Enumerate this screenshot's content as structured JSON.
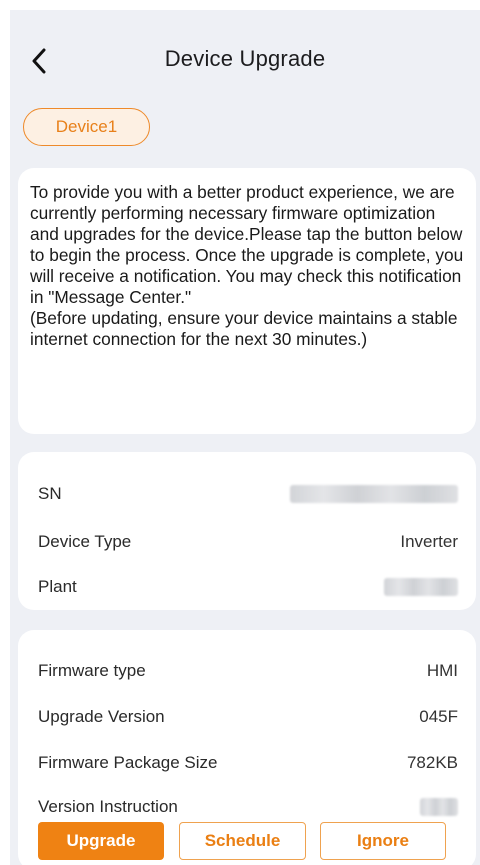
{
  "header": {
    "title": "Device Upgrade",
    "back_icon": "chevron-left-icon"
  },
  "device_tab": {
    "label": "Device1"
  },
  "notice": {
    "text": "To provide you with a better product experience, we are currently performing necessary firmware optimization and upgrades for the device.Please tap the button below to begin the process. Once the upgrade is complete, you will receive a notification. You may check this notification in \"Message Center.\"\n (Before updating, ensure your device maintains a stable internet connection for the next 30 minutes.)"
  },
  "device_info": {
    "sn_label": "SN",
    "device_type_label": "Device Type",
    "device_type_value": "Inverter",
    "plant_label": "Plant"
  },
  "firmware": {
    "type_label": "Firmware type",
    "type_value": "HMI",
    "version_label": "Upgrade Version",
    "version_value": "045F",
    "size_label": "Firmware Package Size",
    "size_value": "782KB",
    "instruction_label": "Version Instruction"
  },
  "actions": {
    "upgrade": "Upgrade",
    "schedule": "Schedule",
    "ignore": "Ignore"
  },
  "colors": {
    "accent": "#ef8213",
    "background": "#eef0f5",
    "card": "#ffffff"
  }
}
